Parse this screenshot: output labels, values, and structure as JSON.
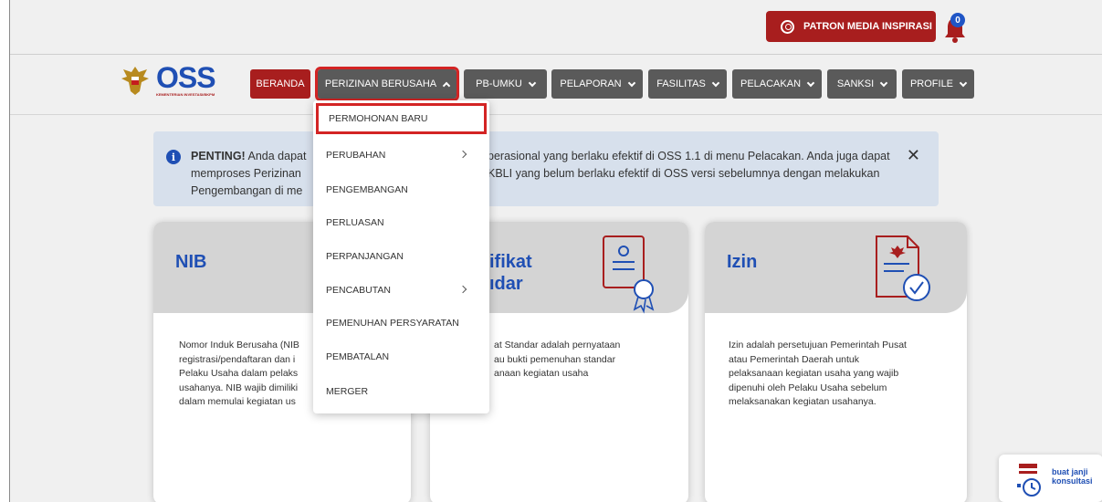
{
  "topbar": {
    "user_label": "PATRON MEDIA INSPIRASI",
    "notification_count": "0"
  },
  "logo": {
    "text": "OSS",
    "subtext": "KEMENTERIAN INVESTASI/BKPM"
  },
  "nav": {
    "items": [
      {
        "label": "BERANDA"
      },
      {
        "label": "PERIZINAN BERUSAHA"
      },
      {
        "label": "PB-UMKU"
      },
      {
        "label": "PELAPORAN"
      },
      {
        "label": "FASILITAS"
      },
      {
        "label": "PELACAKAN"
      },
      {
        "label": "SANKSI"
      },
      {
        "label": "PROFILE"
      }
    ]
  },
  "dropdown": {
    "items": [
      {
        "label": "PERMOHONAN BARU"
      },
      {
        "label": "PERUBAHAN"
      },
      {
        "label": "PENGEMBANGAN"
      },
      {
        "label": "PERLUASAN"
      },
      {
        "label": "PERPANJANGAN"
      },
      {
        "label": "PENCABUTAN"
      },
      {
        "label": "PEMENUHAN PERSYARATAN"
      },
      {
        "label": "PEMBATALAN"
      },
      {
        "label": "MERGER"
      }
    ]
  },
  "alert": {
    "strong": "PENTING!",
    "line1a": " Anda dapat",
    "line1b": "perasional yang berlaku efektif di OSS 1.1 di menu Pelacakan. Anda juga dapat",
    "line2a": "memproses Perizinan",
    "line2b": "KBLI yang belum berlaku efektif di OSS versi sebelumnya dengan melakukan",
    "line3a": "Pengembangan di me"
  },
  "cards": {
    "nib": {
      "title": "NIB",
      "desc": [
        "Nomor Induk Berusaha (NIB",
        "registrasi/pendaftaran dan i",
        "Pelaku Usaha dalam pelaks",
        "usahanya. NIB wajib dimiliki",
        "dalam memulai kegiatan us"
      ]
    },
    "sertifikat": {
      "title_l1": "ifikat",
      "title_l2": "ıdar",
      "desc": [
        "at Standar adalah pernyataan",
        "au bukti pemenuhan standar",
        "anaan kegiatan usaha"
      ]
    },
    "izin": {
      "title": "Izin",
      "desc": [
        "Izin adalah persetujuan Pemerintah Pusat",
        "atau Pemerintah Daerah untuk",
        "pelaksanaan kegiatan usaha yang wajib",
        "dipenuhi oleh Pelaku Usaha sebelum",
        "melaksanakan kegiatan usahanya."
      ]
    }
  },
  "consult": {
    "line1": "buat janji",
    "line2": "konsultasi"
  },
  "colors": {
    "brand_red": "#a81e1e",
    "brand_blue": "#1f4fb4",
    "nav_gray": "#5a5a5a",
    "highlight": "#d32424"
  }
}
